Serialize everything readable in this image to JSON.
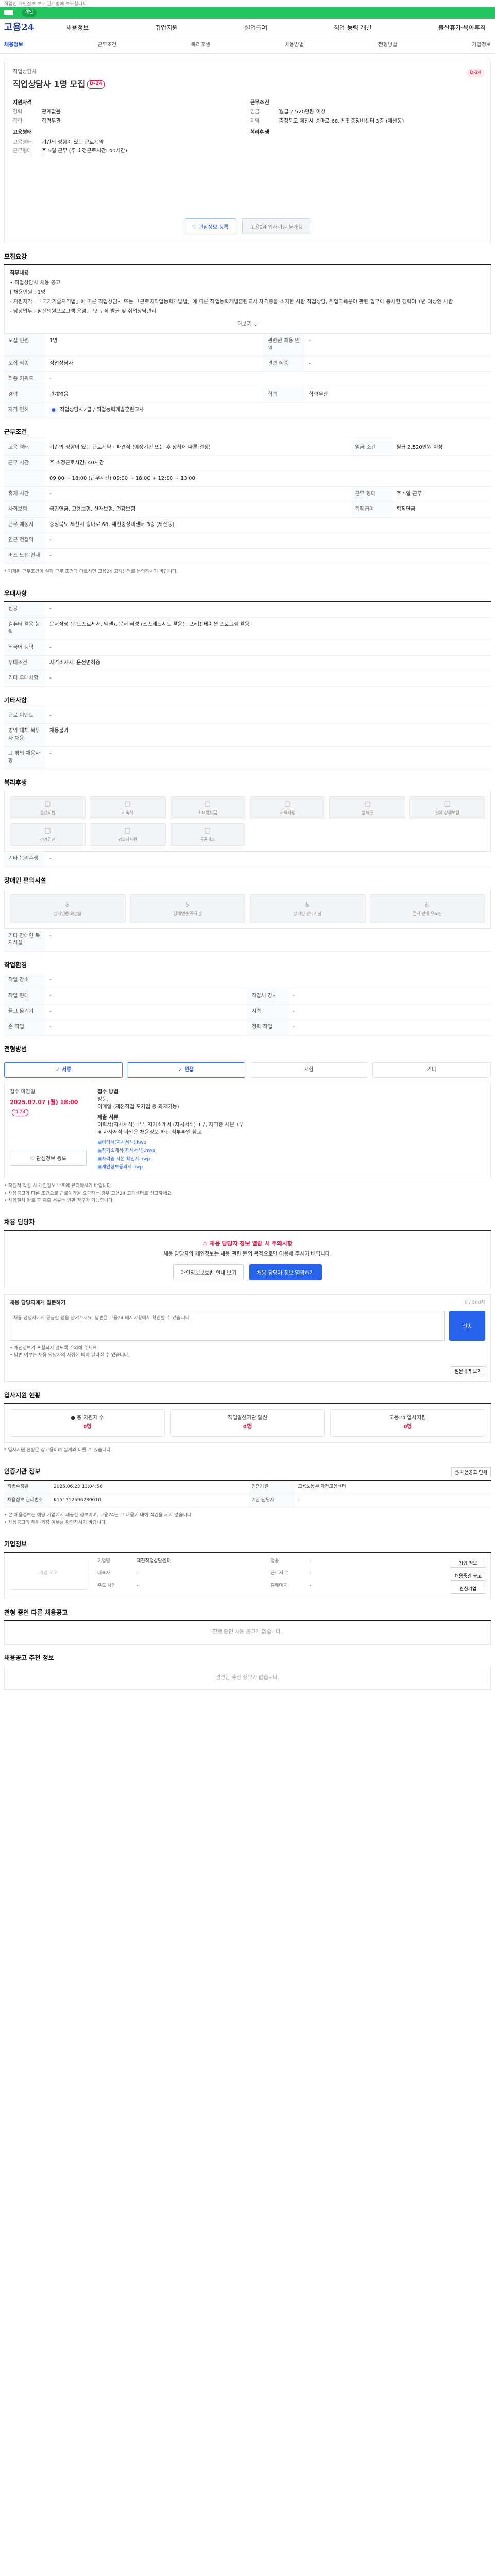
{
  "topbar": {
    "notice": "작업인 개인정보 보호 관계법에 보조합니다."
  },
  "green_bar": {
    "pill": "개인"
  },
  "header": {
    "brand": "고용24",
    "nav": [
      "채용정보",
      "취업지원",
      "실업급여",
      "직업 능력 개발",
      "출산휴가·육아휴직"
    ]
  },
  "subnav": {
    "items": [
      "채용정보",
      "근무조건",
      "복리후생",
      "채용방법",
      "전형방법",
      "기업정보"
    ]
  },
  "job": {
    "company": "직업상담사",
    "title": "직업상담사 1명 모집",
    "dday": "D-24",
    "scrap": "D-24",
    "left_title": "지원자격",
    "left": [
      {
        "k": "경력",
        "v": "관계없음"
      },
      {
        "k": "학력",
        "v": "학력무관"
      }
    ],
    "left2_title": "고용형태",
    "left2": [
      {
        "k": "고용형태",
        "v": "기간의 정함이 있는 근로계약"
      },
      {
        "k": "근무형태",
        "v": "주 5일 근무 (주 소정근로시간: 40시간)"
      }
    ],
    "right_title": "근무조건",
    "right": [
      {
        "k": "임금",
        "v": "월급 2,520만원 이상"
      },
      {
        "k": "지역",
        "v": "충청북도 제천시 승마로 68, 제천중장비센터 3층 (제산동)"
      }
    ],
    "right2_title": "복리후생",
    "btn_scrap": "관심정보 등록",
    "btn_apply": "고용24 입사지원 불가능"
  },
  "recruit": {
    "title": "모집요강",
    "head": "직무내용",
    "lines": [
      "• 직업상담사 채용 공고",
      "[ 채용인원 : 1명",
      "- 지원자격 : 「국가기술자격법」에 따른 직업상담사 또는 「근로자직업능력개발법」에 따른 직업능력개발훈련교사 자격증을 소지한 사람 직업상담, 취업교육분야 관련 업무에 종사한 경력이 1년 이상인 사람",
      "- 담당업무 : 참진의원프로그램 운영, 구인구직 발굴 및 취업상담관리"
    ],
    "more": "더보기"
  },
  "req_table": [
    {
      "k": "모집 인원",
      "v": "1명",
      "k2": "관련된 채용 인원",
      "v2": "-"
    },
    {
      "k": "모집 직종",
      "v": "직업상담사",
      "k2": "관련 직종",
      "v2": "-"
    },
    {
      "k": "직종 키워드",
      "v": "-",
      "k2": "",
      "v2": ""
    },
    {
      "k": "경력",
      "v": "관계없음",
      "k2": "학력",
      "v2": "학력무관"
    },
    {
      "k": "자격 면허",
      "v": "직업상담사2급 / 직업능력개발훈련교사",
      "k2": "",
      "v2": ""
    }
  ],
  "work": {
    "title": "근무조건",
    "rows": [
      {
        "k": "고용 형태",
        "v": "기간의 정함이 있는 근로계약 · 파견직 (예정기간 또는 후 상황에 따른 결정)",
        "k2": "임금 조건",
        "v2": "월급 2,520만원 이상"
      },
      {
        "k": "근무 시간",
        "v": "주 소정근로시간: 40시간",
        "k2": "",
        "v2": ""
      },
      {
        "k": "",
        "v": "09:00 ~ 18:00 (근무시간) 09:00 ~ 18:00 + 12:00 ~ 13:00",
        "k2": "",
        "v2": ""
      },
      {
        "k": "휴게 시간",
        "v": "-",
        "k2": "근무 형태",
        "v2": "주 5일 근무"
      },
      {
        "k": "사회보험",
        "v": "국민연금, 고용보험, 산재보험, 건강보험",
        "k2": "퇴직급여",
        "v2": "퇴직연금"
      },
      {
        "k": "근무 예정지",
        "v": "충청북도 제천시 승마로 68, 제천중장비센터 3층 (제산동)",
        "k2": "",
        "v2": ""
      },
      {
        "k": "인근 전철역",
        "v": "-",
        "k2": "",
        "v2": ""
      },
      {
        "k": "버스 노선 안내",
        "v": "-",
        "k2": "",
        "v2": ""
      }
    ],
    "note": "* 기재된 근무조건이 실제 근무 조건과 다르시면 고용24 고객센터로 문의하시기 바랍니다."
  },
  "prefer": {
    "title": "우대사항",
    "rows": [
      {
        "k": "전공",
        "v": "-"
      },
      {
        "k": "컴퓨터 활용 능력",
        "v": "문서작성 (워드프로세서, 엑셀), 문서 작성 (스프레드시트 활용) , 프레젠테이션 프로그램 활용"
      },
      {
        "k": "외국어 능력",
        "v": "-"
      },
      {
        "k": "우대조건",
        "v": "자격소지자, 운전면허증"
      },
      {
        "k": "기타 우대사항",
        "v": "-"
      }
    ]
  },
  "etc": {
    "title": "기타사항",
    "rows": [
      {
        "k": "근로 이벤트",
        "v": "-"
      },
      {
        "k": "병역 대체 복무자 채용",
        "v": "채용불가"
      }
    ],
    "k3": "그 밖의 채용사항",
    "v3": "-"
  },
  "welfare": {
    "title": "복리후생",
    "cards": [
      "출산지원",
      "기숙사",
      "자녀학자금",
      "교육지원",
      "출퇴근",
      "단체 상해보험",
      "건강검진",
      "경조사지원",
      "통근버스"
    ],
    "k": "기타 복리후생",
    "v": "-"
  },
  "disabled": {
    "title": "장애인 편의시설",
    "cards": [
      "장애인용 화장실",
      "장애인용 주차장",
      "장애인 편의시설",
      "점자 안내 유도판"
    ],
    "k": "기타 장애인 복지시설",
    "v": "-"
  },
  "env": {
    "title": "작업환경",
    "rows": [
      {
        "k": "작업 장소",
        "v": "-",
        "k2": "",
        "v2": ""
      },
      {
        "k": "작업 형태",
        "v": "-",
        "k2": "작업시 장치",
        "v2": "-"
      },
      {
        "k": "들고 옮기기",
        "v": "-",
        "k2": "시력",
        "v2": "-"
      },
      {
        "k": "손 작업",
        "v": "-",
        "k2": "청력 작업",
        "v2": "-"
      }
    ]
  },
  "process": {
    "title": "전형방법",
    "steps": [
      "서류",
      "면접",
      "시험",
      "기타"
    ],
    "left_label": "접수 마감일",
    "deadline": "2025.07.07 (월) 18:00",
    "dday": "D-24",
    "left_btn": "관심정보 등록",
    "right_lines": [
      "접수 방법",
      "방문,",
      "이메일 (제천직업 포기업 등 과제가능)",
      "제출 서류",
      "이력서(자사서식) 1부, 자기소개서 (자사서식) 1부, 자격증 사본 1부",
      "※ 자사서식 파일은 채용정보 하단 첨부파일 참고"
    ],
    "links": [
      "이력서(자사서식).hwp",
      "자기소개서(자사서식).hwp",
      "자격증 사본 확인서.hwp",
      "개인정보동의서.hwp"
    ],
    "notes": [
      "• 지원서 작성 시 개인정보 보호에 유의하시기 바랍니다.",
      "• 채용공고와 다른 조건으로 근로계약을 요구하는 경우 고용24 고객센터로 신고하세요.",
      "• 채용절차 완료 후 제출 서류는 반환 청구가 가능합니다."
    ]
  },
  "manager": {
    "title": "채용 담당자",
    "warn_head": "채용 담당자 정보 열람 시 주의사항",
    "warn_body": "채용 담당자의 개인정보는 채용 관련 문의 목적으로만 이용해 주시기 바랍니다.",
    "btn1": "개인정보보호법 안내 보기",
    "btn2": "채용 담당자 정보 열람하기",
    "qa_title": "채용 담당자에게 질문하기",
    "qa_counter": "0 / 500자",
    "qa_placeholder": "채용 담당자에게 궁금한 점을 남겨주세요. 답변은 고용24 메시지함에서 확인할 수 있습니다.",
    "qa_send": "전송",
    "qa_notes": [
      "• 개인정보가 포함되지 않도록 주의해 주세요.",
      "• 답변 여부는 채용 담당자의 사정에 따라 달라질 수 있습니다."
    ],
    "qa_link": "질문내역 보기"
  },
  "status": {
    "title": "입사지원 현황",
    "items": [
      {
        "label": "총 지원자 수",
        "num": "0명"
      },
      {
        "label": "직업알선기관 알선",
        "num": "0명"
      },
      {
        "label": "고용24 입사지원",
        "num": "0명"
      }
    ],
    "note": "* 입사지원 현황은 참고용이며 실제와 다를 수 있습니다."
  },
  "info": {
    "title": "인증기관 정보",
    "print_btn": "채용공고 인쇄",
    "rows": [
      {
        "k": "최종수정일",
        "v": "2025.06.23 13:04:56",
        "k2": "인증기관",
        "v2": "고용노동부 제천고용센터"
      },
      {
        "k": "채용정보 관리번호",
        "v": "K151312506230010",
        "k2": "기관 담당자",
        "v2": "-"
      }
    ],
    "notes": [
      "• 본 채용정보는 해당 기업에서 제공한 정보이며, 고용24는 그 내용에 대해 책임을 지지 않습니다.",
      "• 채용공고의 허위·과장 여부를 확인하시기 바랍니다."
    ]
  },
  "corp": {
    "title": "기업정보",
    "logo": "기업 로고",
    "fields": [
      {
        "k": "기업명",
        "v": "제천직업상담센터"
      },
      {
        "k": "업종",
        "v": "-"
      },
      {
        "k": "대표자",
        "v": "-"
      },
      {
        "k": "근로자 수",
        "v": "-"
      },
      {
        "k": "주요 사업",
        "v": "-"
      },
      {
        "k": "홈페이지",
        "v": "-"
      }
    ],
    "btn1": "기업 정보",
    "btn2": "채용중인 공고",
    "btn3": "관심기업"
  },
  "other_jobs": {
    "title": "전형 중인 다른 채용공고",
    "empty": "진행 중인 채용 공고가 없습니다."
  },
  "recommend": {
    "title": "채용공고 추천 정보",
    "empty": "관련된 추천 정보가 없습니다."
  }
}
